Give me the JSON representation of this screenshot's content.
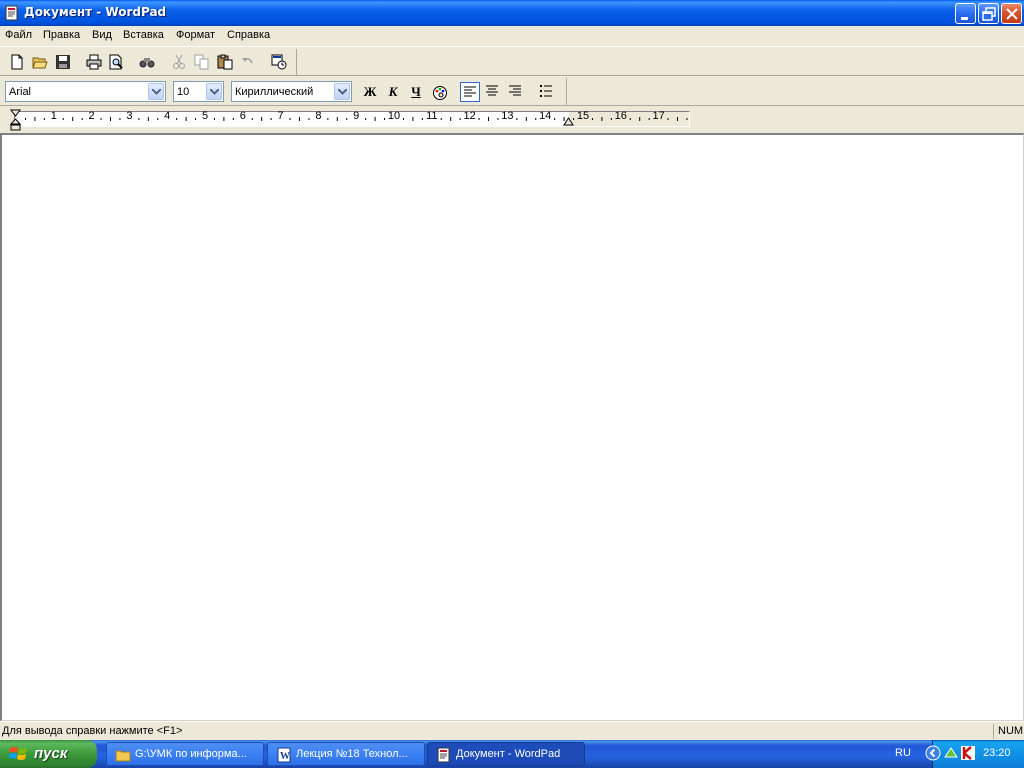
{
  "window": {
    "title": "Документ - WordPad"
  },
  "menu": {
    "items": [
      "Файл",
      "Правка",
      "Вид",
      "Вставка",
      "Формат",
      "Справка"
    ]
  },
  "toolbar": {
    "icons": [
      "new-document-icon",
      "open-folder-icon",
      "save-icon",
      "print-icon",
      "print-preview-icon",
      "find-icon",
      "cut-icon",
      "copy-icon",
      "paste-icon",
      "undo-icon",
      "insert-datetime-icon"
    ]
  },
  "format_bar": {
    "font": "Arial",
    "size": "10",
    "script": "Кириллический",
    "bold": "Ж",
    "italic": "К",
    "underline": "Ч",
    "alignment_selected": "left"
  },
  "ruler": {
    "numbers": [
      "1",
      "2",
      "3",
      "4",
      "5",
      "6",
      "7",
      "8",
      "9",
      "10",
      "11",
      "12",
      "13",
      "14",
      "15",
      "16",
      "17"
    ]
  },
  "statusbar": {
    "help_text": "Для вывода справки нажмите <F1>",
    "num": "NUM"
  },
  "taskbar": {
    "start_label": "пуск",
    "tasks": [
      {
        "label": "G:\\УМК по информа...",
        "active": false
      },
      {
        "label": "Лекция №18 Технол...",
        "active": false
      },
      {
        "label": "Документ - WordPad",
        "active": true
      }
    ],
    "language": "RU",
    "clock": "23:20"
  },
  "colors": {
    "titlebar": "#0A5FE8",
    "face": "#ECE9D8",
    "taskbar": "#2663E0",
    "start": "#3A9A3A",
    "tray": "#1090E6"
  }
}
